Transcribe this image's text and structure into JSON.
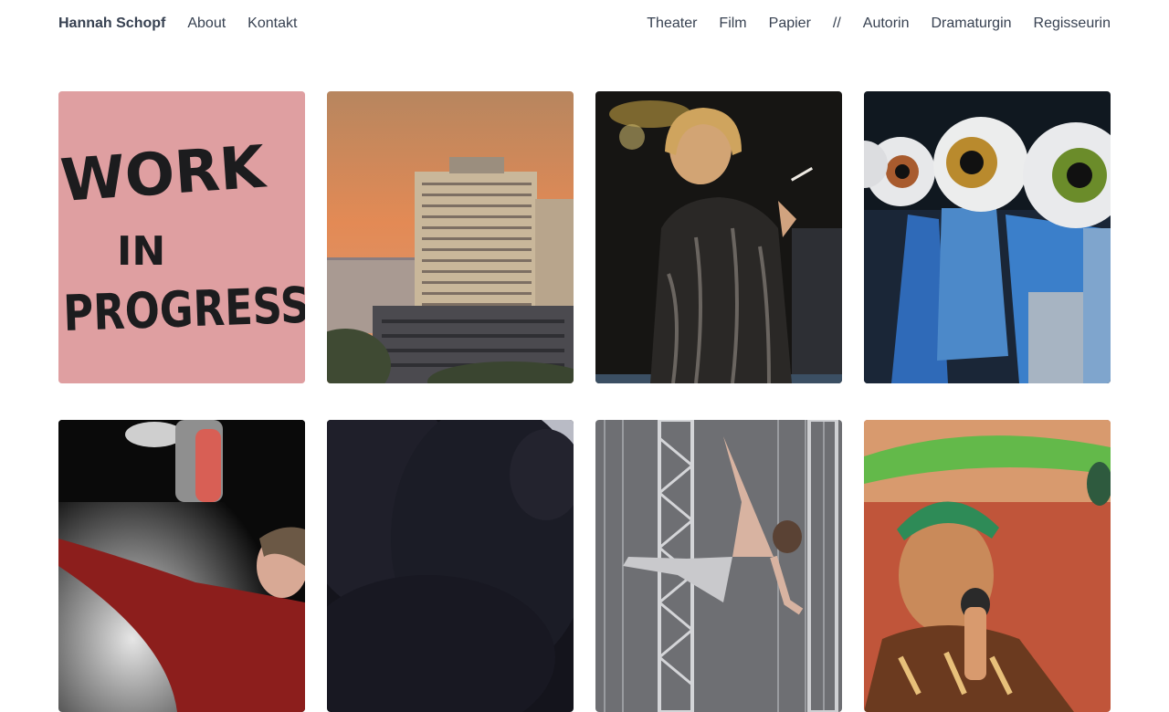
{
  "site": {
    "name": "Hannah Schopf"
  },
  "nav_left": {
    "about": "About",
    "contact": "Kontakt"
  },
  "nav_right": {
    "theater": "Theater",
    "film": "Film",
    "paper": "Papier",
    "separator": "//",
    "author": "Autorin",
    "dramaturg": "Dramaturgin",
    "director": "Regisseurin"
  },
  "gallery": {
    "tile_1": {
      "line1": "WORK",
      "line2": "IN",
      "line3": "PROGRESS"
    }
  },
  "colors": {
    "text": "#374151",
    "background": "#ffffff"
  }
}
